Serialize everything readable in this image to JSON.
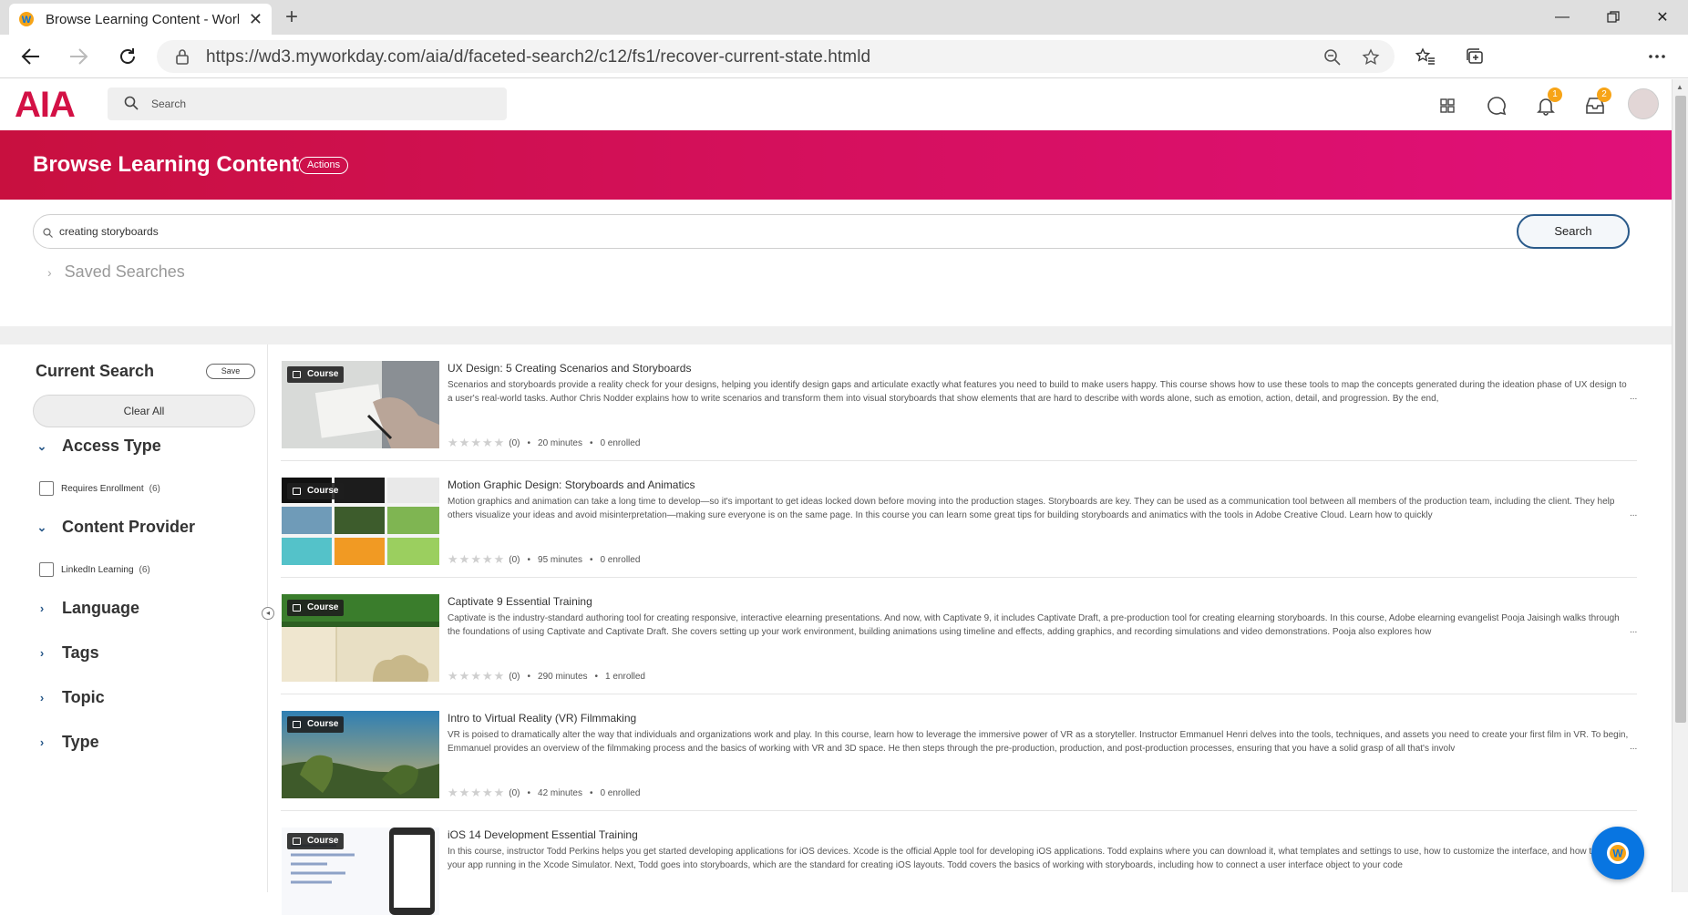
{
  "browser": {
    "tab_title": "Browse Learning Content - Work",
    "url": "https://wd3.myworkday.com/aia/d/faceted-search2/c12/fs1/recover-current-state.htmld"
  },
  "header": {
    "logo": "AIA",
    "search_placeholder": "Search",
    "notifications_count": "1",
    "inbox_count": "2"
  },
  "page": {
    "title": "Browse Learning Content",
    "actions_label": "Actions"
  },
  "search": {
    "query": "creating storyboards",
    "button_label": "Search",
    "saved_searches_label": "Saved Searches"
  },
  "sidebar": {
    "current_search_label": "Current Search",
    "save_label": "Save",
    "clear_all_label": "Clear All",
    "facets": [
      {
        "label": "Access Type",
        "expanded": true,
        "options": [
          {
            "label": "Requires Enrollment",
            "count": "(6)"
          }
        ]
      },
      {
        "label": "Content Provider",
        "expanded": true,
        "options": [
          {
            "label": "LinkedIn Learning",
            "count": "(6)"
          }
        ]
      },
      {
        "label": "Language",
        "expanded": false
      },
      {
        "label": "Tags",
        "expanded": false
      },
      {
        "label": "Topic",
        "expanded": false
      },
      {
        "label": "Type",
        "expanded": false
      }
    ]
  },
  "results": [
    {
      "badge": "Course",
      "title": "UX Design: 5 Creating Scenarios and Storyboards",
      "description": "Scenarios and storyboards provide a reality check for your designs, helping you identify design gaps and articulate exactly what features you need to build to make users happy. This course shows how to use these tools to map the concepts generated during the ideation phase of UX design to a user's real-world tasks. Author Chris Nodder explains how to write scenarios and transform them into visual storyboards that show elements that are hard to describe with words alone, such as emotion, action, detail, and progression. By the end,",
      "rating": "(0)",
      "duration": "20 minutes",
      "enrolled": "0 enrolled"
    },
    {
      "badge": "Course",
      "title": "Motion Graphic Design: Storyboards and Animatics",
      "description": "Motion graphics and animation can take a long time to develop—so it's important to get ideas locked down before moving into the production stages. Storyboards are key. They can be used as a communication tool between all members of the production team, including the client. They help others visualize your ideas and avoid misinterpretation—making sure everyone is on the same page. In this course you can learn some great tips for building storyboards and animatics with the tools in Adobe Creative Cloud. Learn how to quickly",
      "rating": "(0)",
      "duration": "95 minutes",
      "enrolled": "0 enrolled"
    },
    {
      "badge": "Course",
      "title": "Captivate 9 Essential Training",
      "description": "Captivate is the industry-standard authoring tool for creating responsive, interactive elearning presentations. And now, with Captivate 9, it includes Captivate Draft, a pre-production tool for creating elearning storyboards. In this course, Adobe elearning evangelist Pooja Jaisingh walks through the foundations of using Captivate and Captivate Draft. She covers setting up your work environment, building animations using timeline and effects, adding graphics, and recording simulations and video demonstrations. Pooja also explores how",
      "rating": "(0)",
      "duration": "290 minutes",
      "enrolled": "1 enrolled"
    },
    {
      "badge": "Course",
      "title": "Intro to Virtual Reality (VR) Filmmaking",
      "description": "VR is poised to dramatically alter the way that individuals and organizations work and play. In this course, learn how to leverage the immersive power of VR as a storyteller. Instructor Emmanuel Henri delves into the tools, techniques, and assets you need to create your first film in VR. To begin, Emmanuel provides an overview of the filmmaking process and the basics of working with VR and 3D space. He then steps through the pre-production, production, and post-production processes, ensuring that you have a solid grasp of all that's involv",
      "rating": "(0)",
      "duration": "42 minutes",
      "enrolled": "0 enrolled"
    },
    {
      "badge": "Course",
      "title": "iOS 14 Development Essential Training",
      "description": "In this course, instructor Todd Perkins helps you get started developing applications for iOS devices. Xcode is the official Apple tool for developing iOS applications. Todd explains where you can download it, what templates and settings to use, how to customize the interface, and how to get your app running in the Xcode Simulator. Next, Todd goes into storyboards, which are the standard for creating iOS layouts. Todd covers the basics of working with storyboards, including how to connect a user interface object to your code",
      "rating": "",
      "duration": "",
      "enrolled": ""
    }
  ],
  "colors": {
    "brand": "#d31145",
    "band_start": "#c8103f",
    "band_end": "#e1107a",
    "accent_blue": "#2a5a8a",
    "fab": "#0875e1"
  }
}
